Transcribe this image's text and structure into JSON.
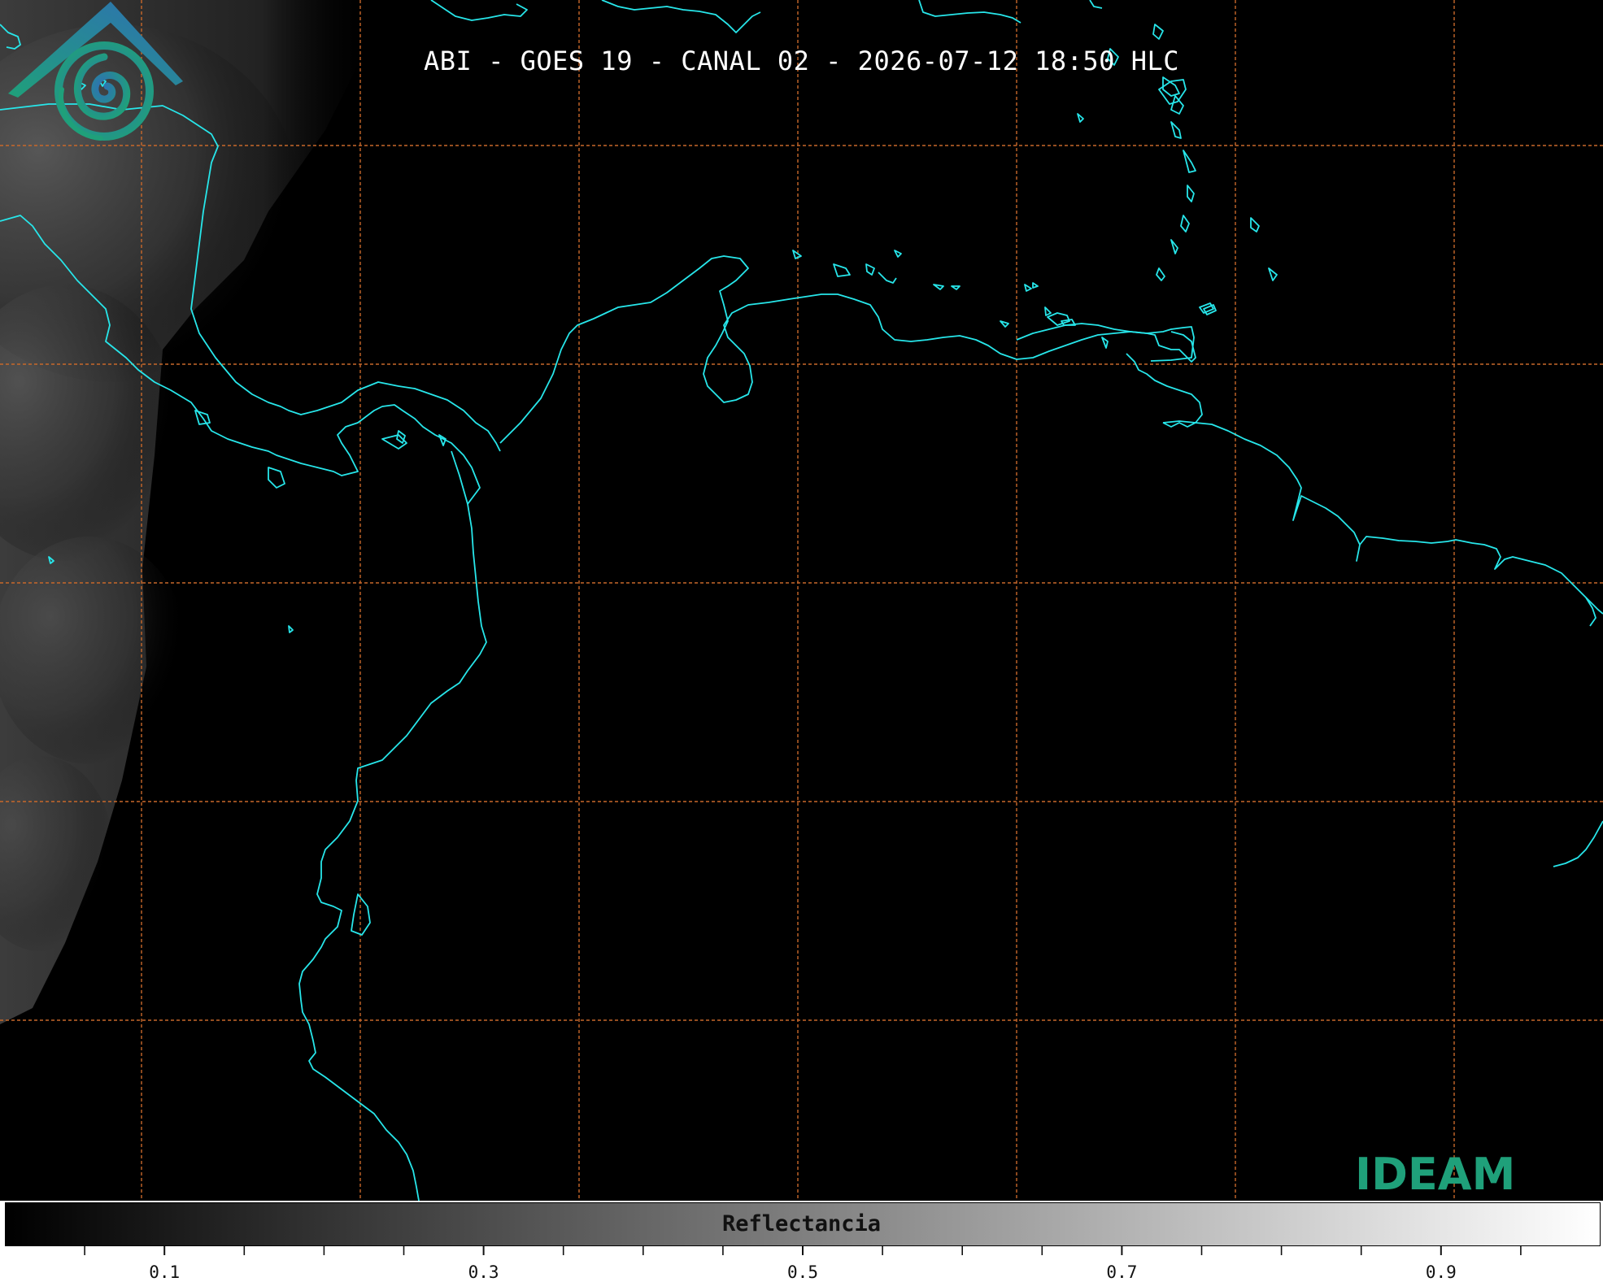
{
  "title": "ABI - GOES 19 - CANAL 02 - 2026-07-12 18:50 HLC",
  "logo": {
    "text": "IDEAM"
  },
  "colorbar": {
    "label": "Reflectancia",
    "min": 0.0,
    "max": 1.0,
    "major_ticks": [
      0.1,
      0.3,
      0.5,
      0.7,
      0.9
    ],
    "major_tick_labels": [
      "0.1",
      "0.3",
      "0.5",
      "0.7",
      "0.9"
    ],
    "minor_ticks": [
      0.05,
      0.15,
      0.2,
      0.25,
      0.35,
      0.4,
      0.45,
      0.55,
      0.6,
      0.65,
      0.75,
      0.8,
      0.85,
      0.95
    ]
  },
  "colors": {
    "coastline": "#27e6ea",
    "gridlines": "#c8682a",
    "background": "#000000",
    "logo_teal": "#1fa07a",
    "logo_blue": "#2f6fb4"
  }
}
